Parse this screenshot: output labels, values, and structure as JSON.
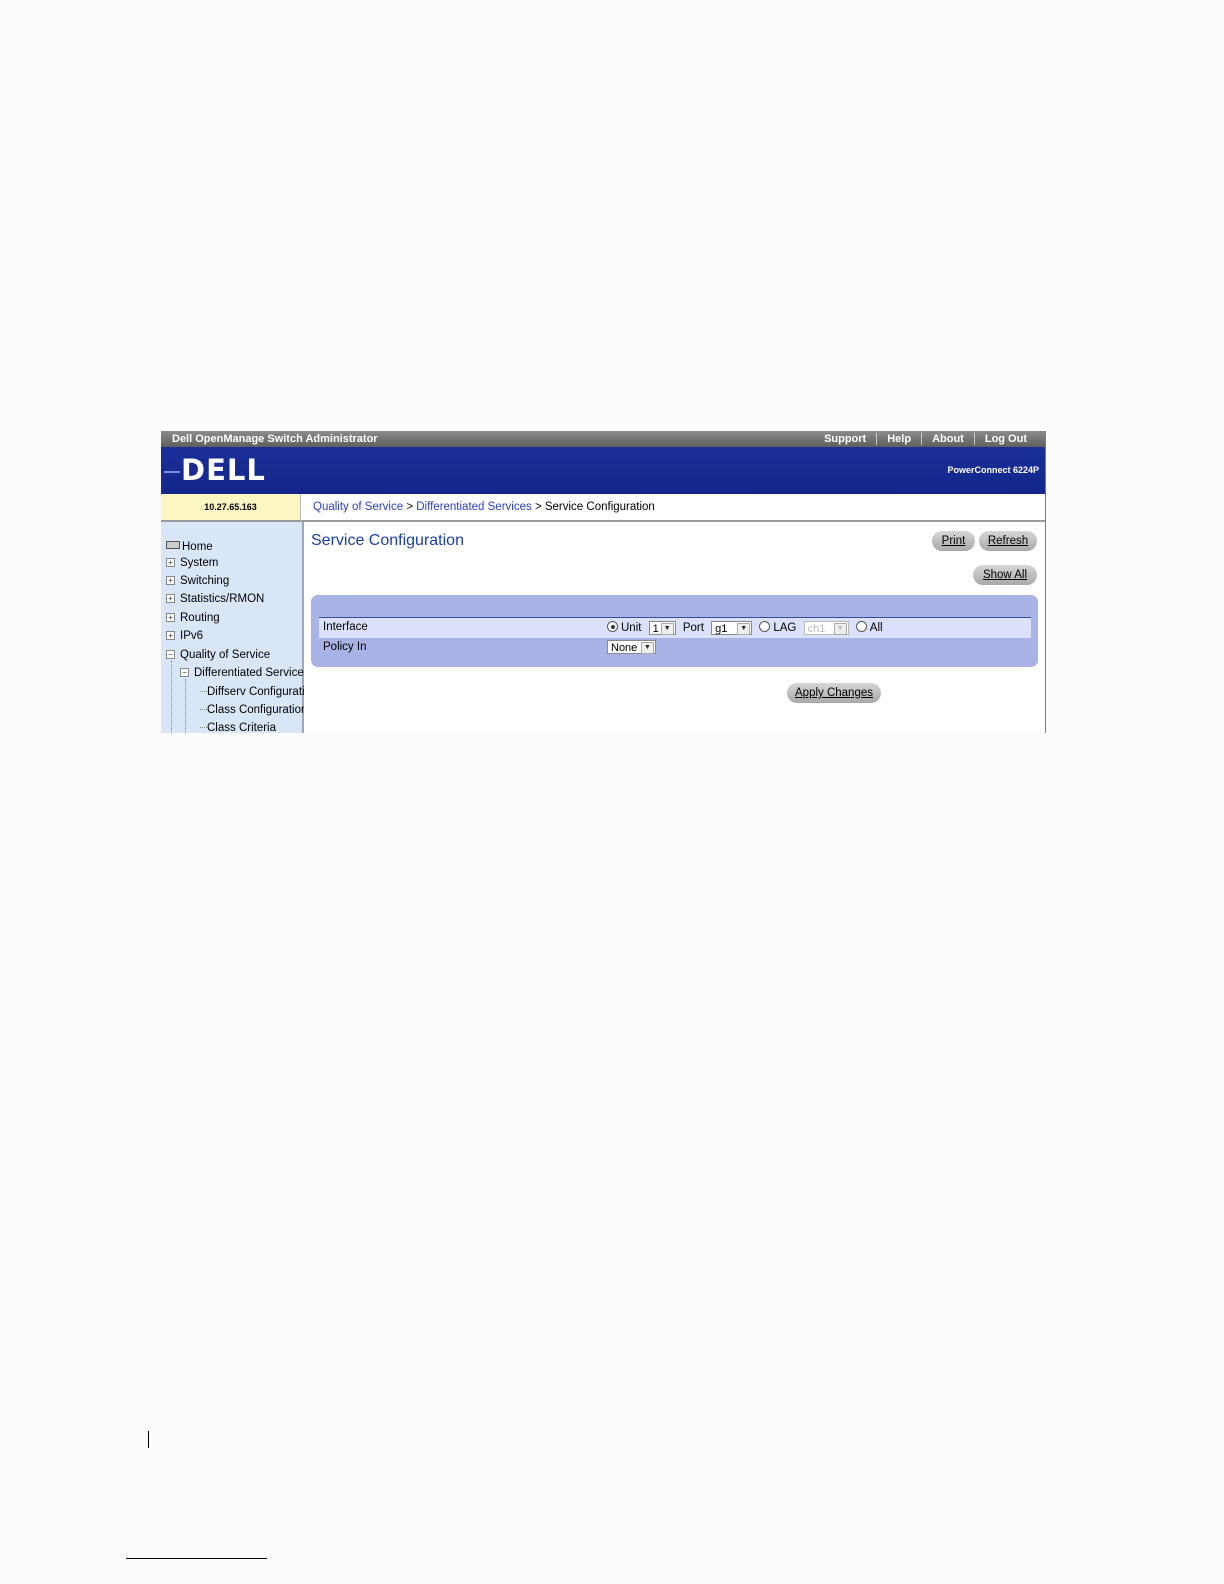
{
  "header": {
    "app_title": "Dell OpenManage Switch Administrator",
    "links": [
      "Support",
      "Help",
      "About",
      "Log Out"
    ],
    "logo": "DELL",
    "model": "PowerConnect 6224P"
  },
  "ip_address": "10.27.65.163",
  "breadcrumb": {
    "items": [
      "Quality of Service",
      "Differentiated Services",
      "Service Configuration"
    ],
    "separator": ">"
  },
  "sidebar": {
    "items": [
      {
        "label": "Home",
        "icon": "home-icon"
      },
      {
        "label": "System",
        "icon": "expand-icon"
      },
      {
        "label": "Switching",
        "icon": "expand-icon"
      },
      {
        "label": "Statistics/RMON",
        "icon": "expand-icon"
      },
      {
        "label": "Routing",
        "icon": "expand-icon"
      },
      {
        "label": "IPv6",
        "icon": "expand-icon"
      },
      {
        "label": "Quality of Service",
        "icon": "collapse-icon"
      },
      {
        "label": "Differentiated Services",
        "icon": "collapse-icon"
      },
      {
        "label": "Diffserv Configuratio"
      },
      {
        "label": "Class Configuration"
      },
      {
        "label": "Class Criteria"
      }
    ]
  },
  "page": {
    "title": "Service Configuration",
    "buttons": {
      "print": "Print",
      "refresh": "Refresh",
      "show_all": "Show All",
      "apply": "Apply Changes"
    }
  },
  "form": {
    "interface": {
      "label": "Interface",
      "unit_label": "Unit",
      "unit_value": "1",
      "port_label": "Port",
      "port_value": "g1",
      "lag_label": "LAG",
      "lag_value": "ch1",
      "all_label": "All",
      "selected": "Unit"
    },
    "policy_in": {
      "label": "Policy In",
      "value": "None"
    }
  },
  "colors": {
    "banner": "#1a2f9a",
    "sidebar": "#d9e6f8",
    "panel": "#aab3e5",
    "title": "#1c3ea8",
    "ip_cell": "#fbf7c2"
  }
}
